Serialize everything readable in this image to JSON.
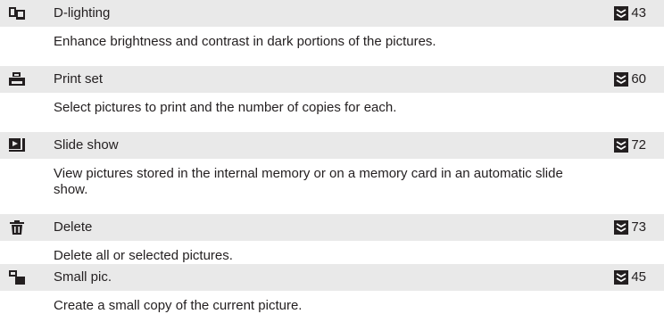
{
  "entries": [
    {
      "icon": "d-lighting-icon",
      "name": "D-lighting",
      "page": "43",
      "description": "Enhance brightness and contrast in dark portions of the pictures."
    },
    {
      "icon": "print-set-icon",
      "name": "Print set",
      "page": "60",
      "description": "Select pictures to print and the number of copies for each."
    },
    {
      "icon": "slide-show-icon",
      "name": "Slide show",
      "page": "72",
      "description": "View pictures stored in the internal memory or on a memory card in an automatic slide show."
    },
    {
      "icon": "delete-icon",
      "name": "Delete",
      "page": "73",
      "description": "Delete all or selected pictures."
    },
    {
      "icon": "small-pic-icon",
      "name": "Small pic.",
      "page": "45",
      "description": "Create a small copy of the current picture."
    }
  ],
  "page_reference_icon": "page-reference-icon"
}
